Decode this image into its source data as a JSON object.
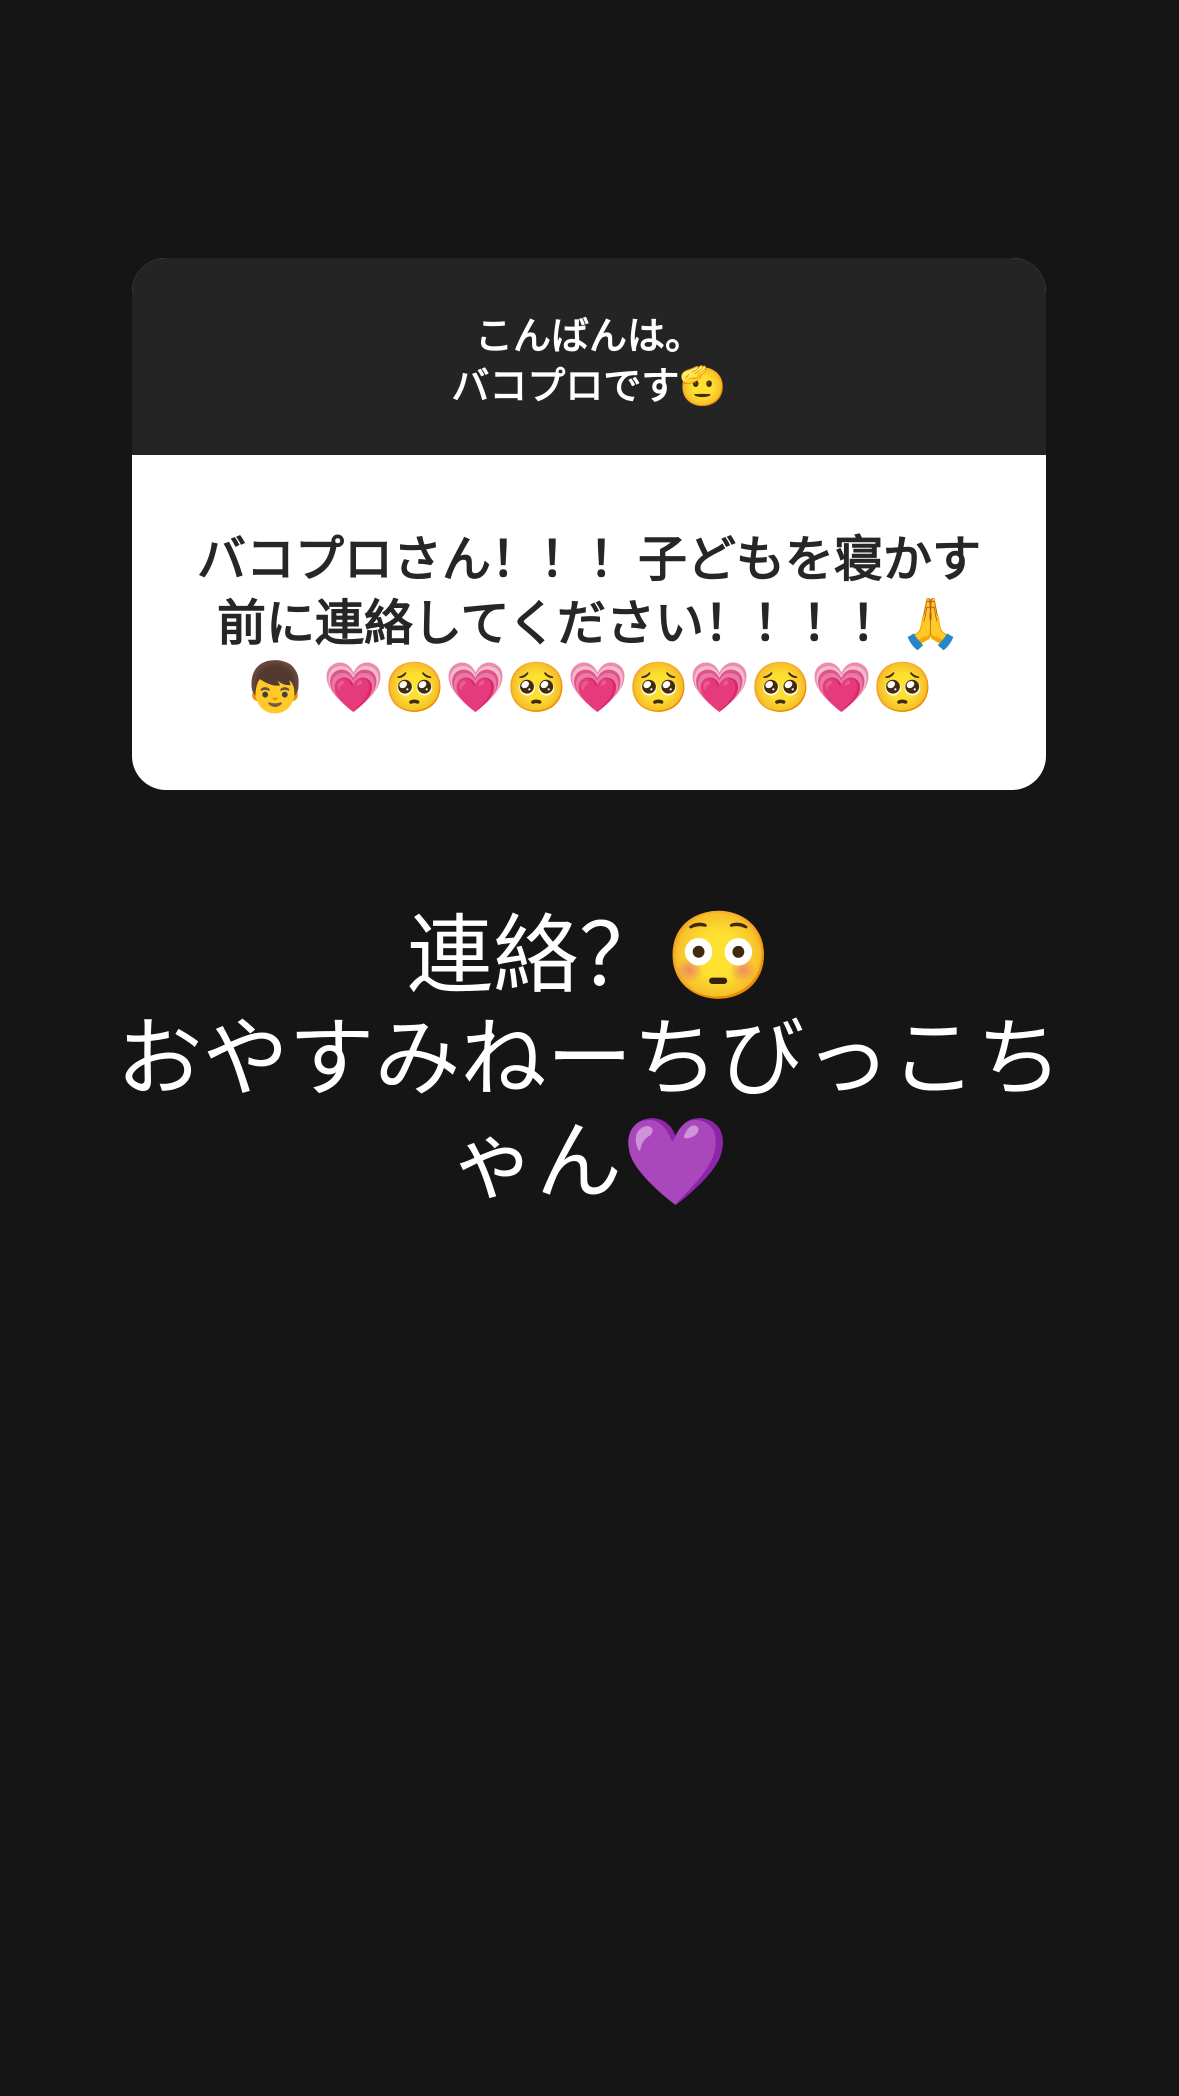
{
  "question_sticker": {
    "prompt": "こんばんは。\nバコプロです🫡",
    "answer": "バコプロさん！！！子どもを寝かす\n前に連絡してください！！！！🙏\n👦 💗🥺💗🥺💗🥺💗🥺💗🥺"
  },
  "story_reply_text": "連絡？😳\nおやすみねーちびっこち\nゃん💜",
  "colors": {
    "background": "#151515",
    "sticker_header": "#242424",
    "sticker_body": "#ffffff"
  }
}
